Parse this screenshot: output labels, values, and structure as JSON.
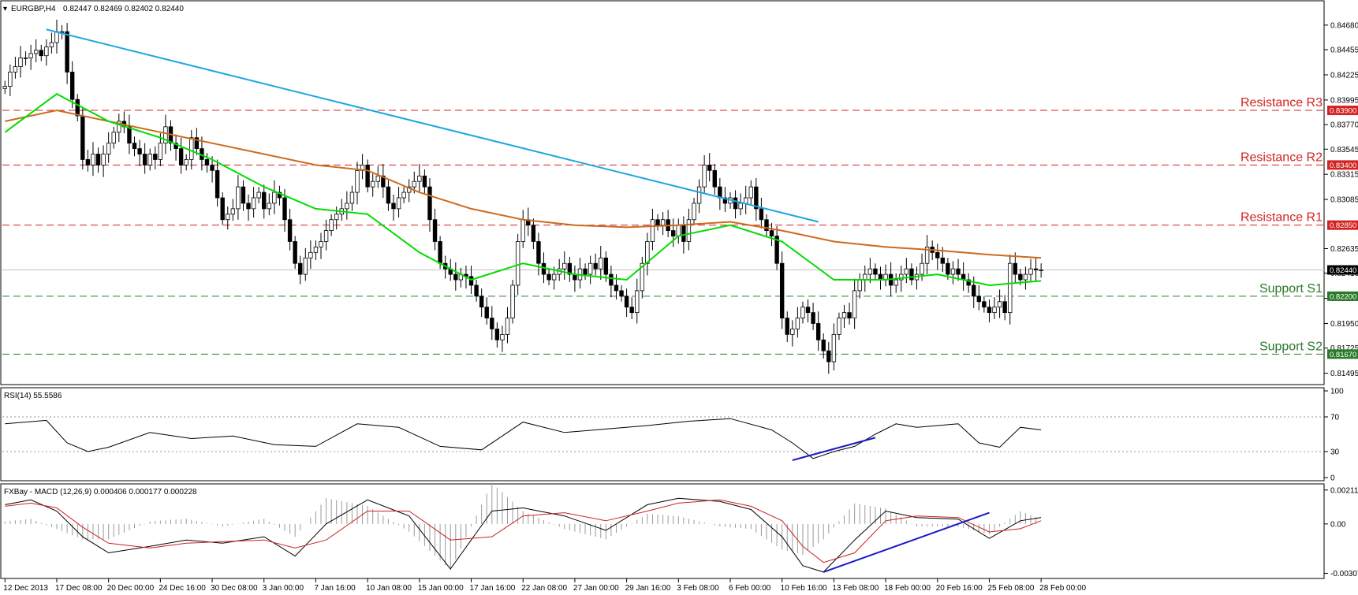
{
  "chart_data": {
    "type": "candlestick",
    "symbol": "EURGBP,H4",
    "ohlc_header": "0.82447 0.82469 0.82402 0.82440",
    "colors": {
      "bull": "#000000",
      "bear": "#000000",
      "sma_fast": "#00dd00",
      "sma_slow": "#cd6a1e",
      "trendline": "#1fa6e0",
      "resistance": "#d22222",
      "support": "#2b7a2b",
      "current_line": "#c0c0c0",
      "rsi_line": "#000000",
      "rsi_trend": "#1a1ac8",
      "macd_line": "#000000",
      "signal_line": "#cc2020",
      "macd_trend": "#1a1ac8",
      "histogram": "#9a9a9a"
    },
    "price_axis": {
      "ylim": [
        0.8142,
        0.8478
      ],
      "ticks": [
        "0.84680",
        "0.84455",
        "0.84225",
        "0.83995",
        "0.83770",
        "0.83545",
        "0.83315",
        "0.83085",
        "0.82635",
        "0.82410",
        "0.82180",
        "0.81950",
        "0.81725",
        "0.81495"
      ],
      "tick_values": [
        0.8468,
        0.84455,
        0.84225,
        0.83995,
        0.8377,
        0.83545,
        0.83315,
        0.83085,
        0.82635,
        0.8241,
        0.8218,
        0.8195,
        0.81725,
        0.81495
      ]
    },
    "levels": [
      {
        "label": "Resistance R3",
        "value": 0.839,
        "tag": "0.83900",
        "kind": "resistance"
      },
      {
        "label": "Resistance R2",
        "value": 0.834,
        "tag": "0.83400",
        "kind": "resistance"
      },
      {
        "label": "Resistance R1",
        "value": 0.8285,
        "tag": "0.82850",
        "kind": "resistance"
      },
      {
        "label": "Support S1",
        "value": 0.822,
        "tag": "0.82200",
        "kind": "support"
      },
      {
        "label": "Support S2",
        "value": 0.8167,
        "tag": "0.81670",
        "kind": "support"
      }
    ],
    "current_price": {
      "value": 0.8244,
      "tag": "0.82440"
    },
    "trendline": {
      "x": [
        8,
        157
      ],
      "y": [
        0.8464,
        0.8288
      ]
    },
    "candles": {
      "x_start": 0,
      "count": 202,
      "open": [
        0.841,
        0.8412,
        0.8425,
        0.843,
        0.8438,
        0.8438,
        0.8442,
        0.8445,
        0.844,
        0.8448,
        0.8452,
        0.8462,
        0.8462,
        0.8425,
        0.84,
        0.8385,
        0.8345,
        0.834,
        0.835,
        0.834,
        0.835,
        0.836,
        0.837,
        0.838,
        0.8375,
        0.836,
        0.8355,
        0.835,
        0.834,
        0.835,
        0.8345,
        0.836,
        0.8375,
        0.836,
        0.8355,
        0.834,
        0.8345,
        0.8365,
        0.8355,
        0.8345,
        0.834,
        0.8335,
        0.831,
        0.829,
        0.8295,
        0.83,
        0.832,
        0.8305,
        0.83,
        0.831,
        0.8315,
        0.83,
        0.8305,
        0.8315,
        0.831,
        0.829,
        0.827,
        0.825,
        0.824,
        0.8255,
        0.826,
        0.8265,
        0.827,
        0.828,
        0.829,
        0.8295,
        0.83,
        0.8305,
        0.8315,
        0.8335,
        0.834,
        0.832,
        0.8325,
        0.833,
        0.832,
        0.8305,
        0.83,
        0.831,
        0.8315,
        0.832,
        0.8325,
        0.833,
        0.832,
        0.829,
        0.827,
        0.825,
        0.8245,
        0.824,
        0.8235,
        0.824,
        0.8238,
        0.823,
        0.822,
        0.821,
        0.82,
        0.819,
        0.818,
        0.8185,
        0.82,
        0.823,
        0.827,
        0.829,
        0.8285,
        0.827,
        0.825,
        0.824,
        0.8235,
        0.824,
        0.8245,
        0.825,
        0.824,
        0.8235,
        0.8245,
        0.824,
        0.825,
        0.8245,
        0.8255,
        0.824,
        0.823,
        0.8225,
        0.822,
        0.821,
        0.8205,
        0.8225,
        0.825,
        0.827,
        0.829,
        0.8285,
        0.829,
        0.828,
        0.8275,
        0.8285,
        0.827,
        0.829,
        0.8305,
        0.832,
        0.834,
        0.8335,
        0.832,
        0.831,
        0.8305,
        0.831,
        0.83,
        0.8305,
        0.831,
        0.832,
        0.83,
        0.829,
        0.828,
        0.8275,
        0.825,
        0.82,
        0.8185,
        0.819,
        0.82,
        0.821,
        0.8205,
        0.8195,
        0.818,
        0.817,
        0.816,
        0.8185,
        0.82,
        0.8205,
        0.82,
        0.8225,
        0.8235,
        0.824,
        0.8245,
        0.824,
        0.8235,
        0.824,
        0.823,
        0.8235,
        0.824,
        0.8245,
        0.8235,
        0.824,
        0.825,
        0.8265,
        0.826,
        0.8255,
        0.825,
        0.824,
        0.8245,
        0.824,
        0.8235,
        0.823,
        0.822,
        0.8215,
        0.821,
        0.8205,
        0.821,
        0.8215,
        0.8205,
        0.825,
        0.824,
        0.8235,
        0.824,
        0.8245,
        0.8244
      ],
      "close": [
        0.8412,
        0.8425,
        0.843,
        0.8438,
        0.8438,
        0.8442,
        0.8445,
        0.844,
        0.8448,
        0.8452,
        0.8462,
        0.8462,
        0.8425,
        0.84,
        0.8385,
        0.8345,
        0.834,
        0.835,
        0.834,
        0.835,
        0.836,
        0.837,
        0.838,
        0.8375,
        0.836,
        0.8355,
        0.835,
        0.834,
        0.835,
        0.8345,
        0.836,
        0.8375,
        0.836,
        0.8355,
        0.834,
        0.8345,
        0.8365,
        0.8355,
        0.8345,
        0.834,
        0.8335,
        0.831,
        0.829,
        0.8295,
        0.83,
        0.832,
        0.8305,
        0.83,
        0.831,
        0.8315,
        0.83,
        0.8305,
        0.8315,
        0.831,
        0.829,
        0.827,
        0.825,
        0.824,
        0.8255,
        0.826,
        0.8265,
        0.827,
        0.828,
        0.829,
        0.8295,
        0.83,
        0.8305,
        0.8315,
        0.8335,
        0.834,
        0.832,
        0.8325,
        0.833,
        0.832,
        0.8305,
        0.83,
        0.831,
        0.8315,
        0.832,
        0.8325,
        0.833,
        0.832,
        0.829,
        0.827,
        0.825,
        0.8245,
        0.824,
        0.8235,
        0.824,
        0.8238,
        0.823,
        0.822,
        0.821,
        0.82,
        0.819,
        0.818,
        0.8185,
        0.82,
        0.823,
        0.827,
        0.829,
        0.8285,
        0.827,
        0.825,
        0.824,
        0.8235,
        0.824,
        0.8245,
        0.825,
        0.824,
        0.8235,
        0.8245,
        0.824,
        0.825,
        0.8245,
        0.8255,
        0.824,
        0.823,
        0.8225,
        0.822,
        0.821,
        0.8205,
        0.8225,
        0.825,
        0.827,
        0.829,
        0.8285,
        0.829,
        0.828,
        0.8275,
        0.8285,
        0.827,
        0.829,
        0.8305,
        0.832,
        0.834,
        0.8335,
        0.832,
        0.831,
        0.8305,
        0.831,
        0.83,
        0.8305,
        0.831,
        0.832,
        0.83,
        0.829,
        0.828,
        0.8275,
        0.825,
        0.82,
        0.8185,
        0.819,
        0.82,
        0.821,
        0.8205,
        0.8195,
        0.818,
        0.817,
        0.816,
        0.8185,
        0.82,
        0.8205,
        0.82,
        0.8225,
        0.8235,
        0.824,
        0.8245,
        0.824,
        0.8235,
        0.824,
        0.823,
        0.8235,
        0.824,
        0.8245,
        0.8235,
        0.824,
        0.825,
        0.8265,
        0.826,
        0.8255,
        0.825,
        0.824,
        0.8245,
        0.824,
        0.8235,
        0.823,
        0.822,
        0.8215,
        0.821,
        0.8205,
        0.821,
        0.8215,
        0.8205,
        0.825,
        0.824,
        0.8235,
        0.824,
        0.8245,
        0.8244,
        0.8244
      ]
    },
    "sma_fast": {
      "x": [
        0,
        10,
        20,
        30,
        40,
        50,
        60,
        70,
        80,
        90,
        100,
        110,
        120,
        130,
        140,
        150,
        160,
        170,
        180,
        190,
        200
      ],
      "y": [
        0.837,
        0.8405,
        0.838,
        0.8365,
        0.8345,
        0.832,
        0.83,
        0.8295,
        0.826,
        0.8235,
        0.825,
        0.824,
        0.8235,
        0.8275,
        0.8285,
        0.827,
        0.8235,
        0.8235,
        0.824,
        0.823,
        0.8234
      ]
    },
    "sma_slow": {
      "x": [
        0,
        10,
        20,
        30,
        40,
        50,
        60,
        70,
        80,
        90,
        100,
        110,
        120,
        130,
        140,
        150,
        160,
        170,
        180,
        190,
        200
      ],
      "y": [
        0.838,
        0.839,
        0.838,
        0.837,
        0.836,
        0.835,
        0.834,
        0.8335,
        0.8315,
        0.83,
        0.829,
        0.8285,
        0.8283,
        0.8285,
        0.8288,
        0.828,
        0.827,
        0.8265,
        0.8262,
        0.8258,
        0.8255
      ]
    },
    "rsi": {
      "label": "RSI(14) 55.5586",
      "ticks": [
        "100",
        "70",
        "30",
        "0"
      ],
      "tick_values": [
        100,
        70,
        30,
        0
      ],
      "values_x": [
        0,
        8,
        12,
        16,
        20,
        28,
        36,
        44,
        52,
        60,
        68,
        76,
        84,
        92,
        100,
        108,
        116,
        124,
        132,
        140,
        148,
        152,
        156,
        160,
        164,
        168,
        172,
        176,
        180,
        184,
        188,
        192,
        196,
        200
      ],
      "values_y": [
        62,
        66,
        40,
        30,
        35,
        52,
        45,
        48,
        38,
        36,
        62,
        58,
        36,
        32,
        64,
        52,
        56,
        60,
        65,
        68,
        55,
        40,
        22,
        30,
        36,
        50,
        62,
        58,
        60,
        62,
        40,
        35,
        58,
        55
      ],
      "trend": {
        "x": [
          152,
          168
        ],
        "y": [
          20,
          46
        ]
      }
    },
    "macd": {
      "label": "FXBay - MACD (12,26,9) 0.000406 0.000177 0.000228",
      "ticks": [
        "0.002114",
        "0.00",
        "-0.003076"
      ],
      "tick_values": [
        0.002114,
        0.0,
        -0.003076
      ],
      "ylim": [
        -0.0032,
        0.0023
      ],
      "macd_x": [
        0,
        5,
        10,
        15,
        20,
        28,
        35,
        42,
        50,
        56,
        62,
        70,
        78,
        86,
        94,
        100,
        108,
        116,
        124,
        130,
        138,
        144,
        150,
        154,
        158,
        164,
        170,
        176,
        184,
        190,
        196,
        200
      ],
      "macd_y": [
        0.0012,
        0.0015,
        0.0008,
        -0.0008,
        -0.0018,
        -0.0014,
        -0.001,
        -0.0012,
        -0.0008,
        -0.002,
        0.0,
        0.0015,
        0.0005,
        -0.0028,
        0.0008,
        0.001,
        0.0005,
        -0.0004,
        0.0012,
        0.0016,
        0.0014,
        0.0009,
        -0.0008,
        -0.0026,
        -0.003,
        -0.001,
        0.0008,
        0.0004,
        0.0003,
        -0.0009,
        0.0002,
        0.0004
      ],
      "signal_x": [
        0,
        5,
        10,
        15,
        20,
        28,
        35,
        42,
        50,
        56,
        62,
        70,
        78,
        86,
        94,
        100,
        108,
        116,
        124,
        130,
        138,
        144,
        150,
        154,
        158,
        164,
        170,
        176,
        184,
        190,
        196,
        200
      ],
      "signal_y": [
        0.0011,
        0.0013,
        0.001,
        -0.0002,
        -0.0012,
        -0.0015,
        -0.0012,
        -0.0011,
        -0.001,
        -0.0015,
        -0.001,
        0.0008,
        0.0008,
        -0.001,
        -0.0008,
        0.0005,
        0.0007,
        0.0002,
        0.0008,
        0.0013,
        0.0015,
        0.0011,
        0.0002,
        -0.0014,
        -0.0024,
        -0.0018,
        0.0002,
        0.0005,
        0.0004,
        -0.0005,
        -0.0003,
        0.0002
      ],
      "trend": {
        "x": [
          158,
          190
        ],
        "y": [
          -0.003,
          0.0007
        ]
      }
    },
    "x_axis": {
      "labels": [
        "12 Dec 2013",
        "17 Dec 08:00",
        "20 Dec 00:00",
        "24 Dec 16:00",
        "30 Dec 08:00",
        "3 Jan 00:00",
        "7 Jan 16:00",
        "10 Jan 08:00",
        "15 Jan 00:00",
        "17 Jan 16:00",
        "22 Jan 08:00",
        "27 Jan 00:00",
        "29 Jan 16:00",
        "3 Feb 08:00",
        "6 Feb 00:00",
        "10 Feb 16:00",
        "13 Feb 08:00",
        "18 Feb 00:00",
        "20 Feb 16:00",
        "25 Feb 08:00",
        "28 Feb 00:00"
      ],
      "label_index": [
        0,
        10,
        20,
        30,
        40,
        50,
        60,
        70,
        80,
        90,
        100,
        110,
        120,
        130,
        140,
        150,
        160,
        170,
        180,
        190,
        200
      ]
    }
  }
}
